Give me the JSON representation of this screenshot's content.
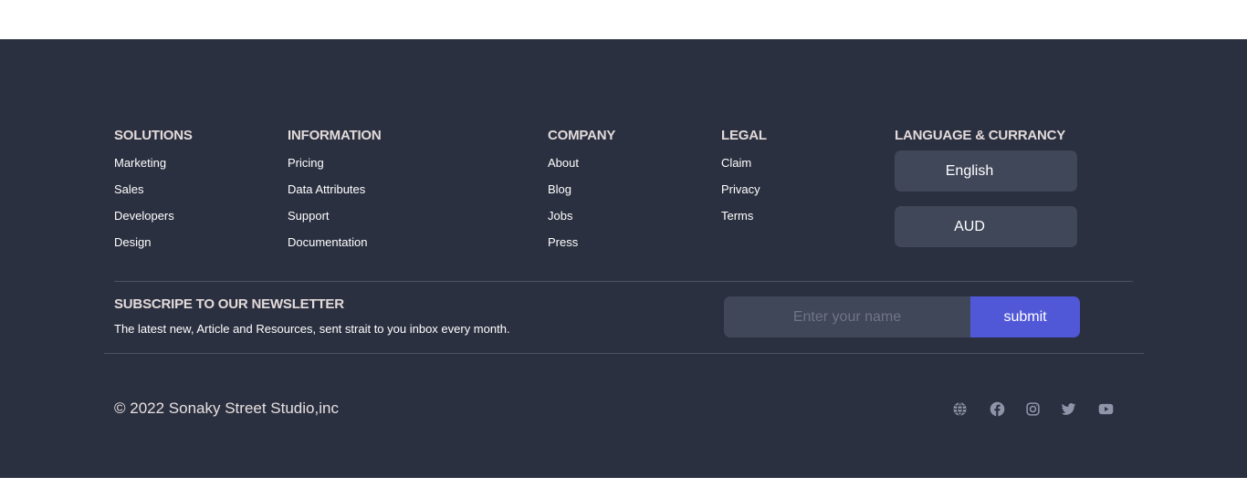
{
  "footer": {
    "columns": [
      {
        "title": "SOLUTIONS",
        "links": [
          "Marketing",
          "Sales",
          "Developers",
          "Design"
        ]
      },
      {
        "title": "INFORMATION",
        "links": [
          "Pricing",
          "Data Attributes",
          "Support",
          "Documentation"
        ]
      },
      {
        "title": "COMPANY",
        "links": [
          "About",
          "Blog",
          "Jobs",
          "Press"
        ]
      },
      {
        "title": "LEGAL",
        "links": [
          "Claim",
          "Privacy",
          "Terms"
        ]
      }
    ],
    "language_currency": {
      "title": "LANGUAGE & CURRANCY",
      "language": "English",
      "currency": "AUD"
    },
    "newsletter": {
      "title": "SUBSCRIPE TO OUR NEWSLETTER",
      "text": "The latest new, Article and Resources, sent strait to you inbox every month.",
      "placeholder": "Enter your name",
      "submit_label": "submit"
    },
    "copyright": "© 2022 Sonaky Street Studio,inc",
    "social_icons": [
      "globe-icon",
      "facebook-icon",
      "instagram-icon",
      "twitter-icon",
      "youtube-icon"
    ],
    "colors": {
      "background": "#2b3040",
      "field": "#404759",
      "accent": "#5158d8",
      "icon": "#8e95a8"
    }
  }
}
